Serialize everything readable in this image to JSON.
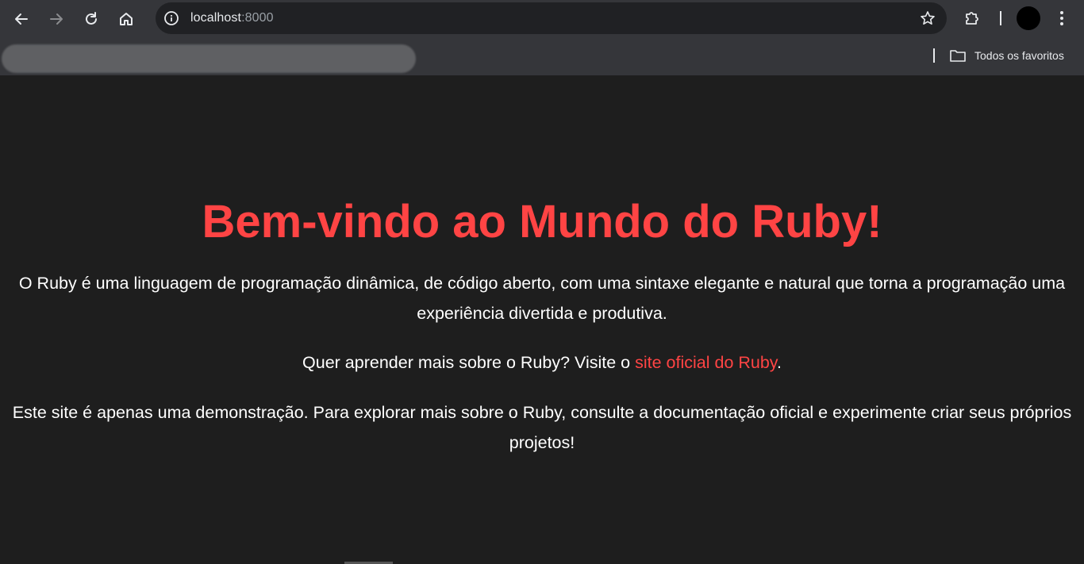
{
  "browser": {
    "url_host": "localhost",
    "url_port": ":8000",
    "bookmarks_label": "Todos os favoritos",
    "icons": [
      "back-arrow-icon",
      "forward-arrow-icon",
      "reload-icon",
      "home-icon",
      "info-icon",
      "star-icon",
      "puzzle-icon",
      "kebab-menu-icon",
      "folder-icon"
    ]
  },
  "page": {
    "heading": "Bem-vindo ao Mundo do Ruby!",
    "intro": "O Ruby é uma linguagem de programação dinâmica, de código aberto, com uma sintaxe elegante e natural que torna a programação uma experiência divertida e produtiva.",
    "learn_prefix": "Quer aprender mais sobre o Ruby? Visite o ",
    "learn_link": "site oficial do Ruby",
    "learn_suffix": ".",
    "demo_note": "Este site é apenas uma demonstração. Para explorar mais sobre o Ruby, consulte a documentação oficial e experimente criar seus próprios projetos!"
  },
  "colors": {
    "accent": "#ff4444",
    "page_background": "#1e1e1e",
    "toolbar_background": "#35363a",
    "omnibox_background": "#202124"
  }
}
